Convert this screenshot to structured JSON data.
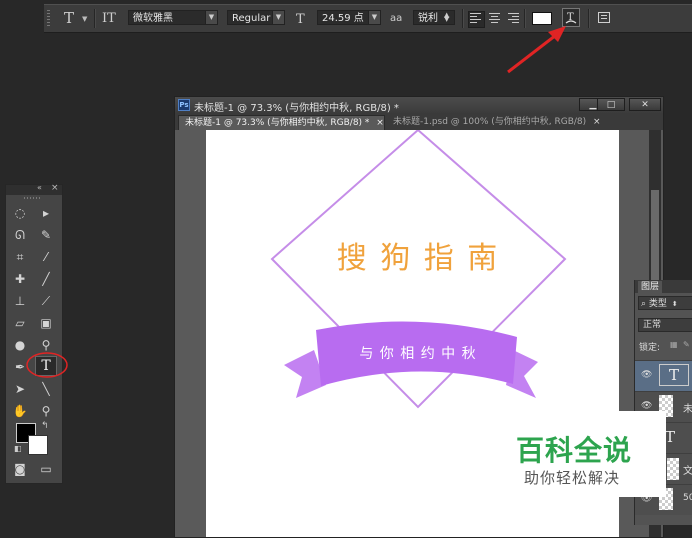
{
  "options_bar": {
    "tool_glyph": "T",
    "orient_glyph": "IT",
    "font_family": "微软雅黑",
    "font_style": "Regular",
    "size_glyph": "T",
    "font_size": "24.59 点",
    "aa_glyph": "aa",
    "antialias": "锐利",
    "text_color": "#ffffff",
    "warp_icon": "warp-text-icon",
    "panel_icon": "character-panel-icon"
  },
  "document": {
    "app_badge": "Ps",
    "window_title": "未标题-1 @ 73.3% (与你相约中秋, RGB/8) *",
    "min_glyph": "▁",
    "max_glyph": "□",
    "close_glyph": "✕",
    "tabs": [
      {
        "label": "未标题-1 @ 73.3% (与你相约中秋, RGB/8) *",
        "close": "×"
      },
      {
        "label": "未标题-1.psd @ 100% (与你相约中秋, RGB/8)",
        "close": "×"
      }
    ]
  },
  "artwork": {
    "title": "搜 狗 指 南",
    "ribbon_text": "与 你 相 约 中 秋",
    "title_color": "#f0a23c",
    "line_color": "#c58de8",
    "ribbon_color": "#b86cf0"
  },
  "layers_panel": {
    "tab": "图层",
    "kind_filter": "类型",
    "blend_mode": "正常",
    "lock_label": "锁定:",
    "rows": [
      {
        "thumb": "T",
        "name": ""
      },
      {
        "thumb": "",
        "name": "未"
      },
      {
        "thumb": "T",
        "name": ""
      },
      {
        "thumb": "",
        "name": "文"
      },
      {
        "thumb": "",
        "name": "50"
      }
    ]
  },
  "watermark": {
    "title": "百科全说",
    "subtitle": "助你轻松解决"
  },
  "annotation": {
    "arrow_color": "#e02424",
    "circle_color": "#e02424"
  }
}
